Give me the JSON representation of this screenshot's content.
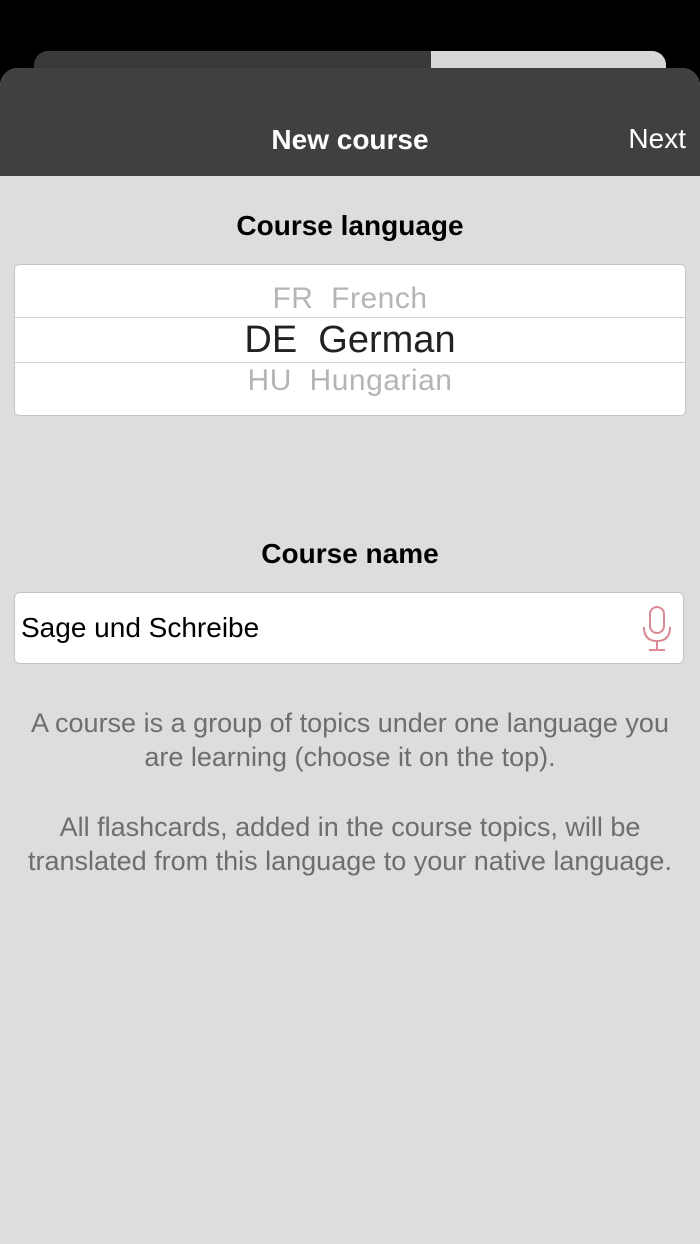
{
  "navbar": {
    "title": "New course",
    "next_label": "Next"
  },
  "course_language": {
    "heading": "Course language",
    "options": [
      {
        "code": "FR",
        "name": "French",
        "label": "FR  French",
        "selected": false
      },
      {
        "code": "DE",
        "name": "German",
        "label": "DE  German",
        "selected": true
      },
      {
        "code": "HU",
        "name": "Hungarian",
        "label": "HU  Hungarian",
        "selected": false
      }
    ]
  },
  "course_name": {
    "heading": "Course name",
    "value": "Sage und Schreibe"
  },
  "help": {
    "paragraph1": "A course is a group of topics under one language you are learning (choose it on the top).",
    "paragraph2": "All flashcards, added in the course topics, will be translated from this language to your native language."
  },
  "colors": {
    "navbar_bg": "#404040",
    "sheet_bg": "#dddddd",
    "mic_icon": "#d98a94"
  },
  "icons": {
    "mic": "microphone-icon"
  }
}
